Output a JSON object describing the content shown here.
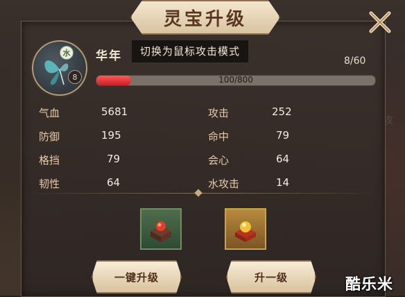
{
  "window": {
    "title": "灵宝升级"
  },
  "pet": {
    "name": "华年",
    "element": "水",
    "level": "8"
  },
  "tooltip": "切换为鼠标攻击模式",
  "exp": {
    "count": "8/60",
    "text": "100/800",
    "fraction": 0.125
  },
  "stats": {
    "left": [
      {
        "label": "气血",
        "value": "5681"
      },
      {
        "label": "防御",
        "value": "195"
      },
      {
        "label": "格挡",
        "value": "79"
      },
      {
        "label": "韧性",
        "value": "64"
      }
    ],
    "right": [
      {
        "label": "攻击",
        "value": "252"
      },
      {
        "label": "命中",
        "value": "79"
      },
      {
        "label": "会心",
        "value": "64"
      },
      {
        "label": "水攻击",
        "value": "14"
      }
    ]
  },
  "buttons": {
    "one_click": "一键升级",
    "upgrade": "升一级"
  },
  "watermark": "酷乐米",
  "colors": {
    "accent_red": "#d8262c",
    "panel_bg": "#3a302c",
    "label_tan": "#e6c9a6"
  },
  "icons": {
    "close": "close-x-icon",
    "pet": "butterfly-icon",
    "item1": "red-orb-box-icon",
    "item2": "gold-orb-box-icon"
  }
}
